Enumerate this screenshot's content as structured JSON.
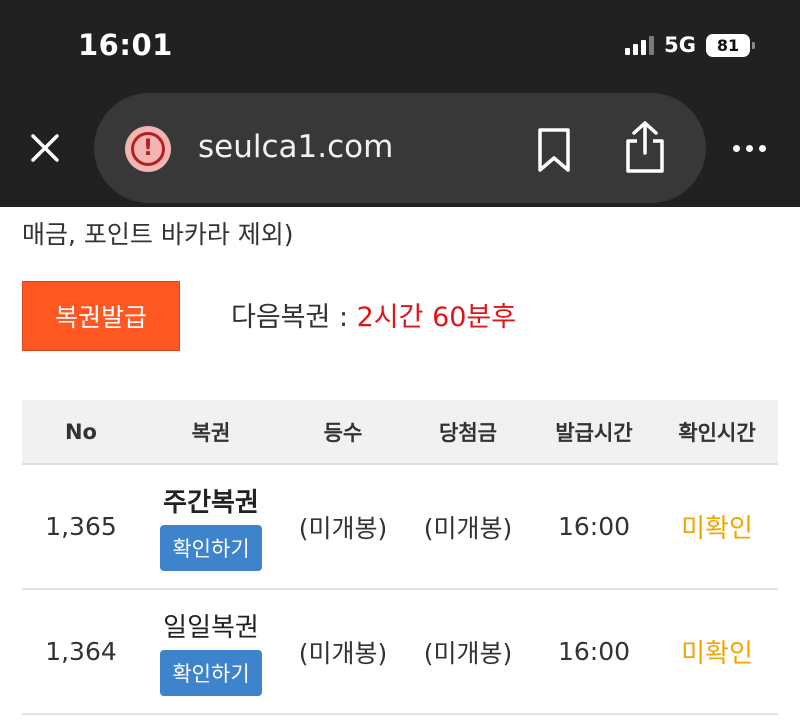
{
  "status_bar": {
    "time": "16:01",
    "network": "5G",
    "battery": "81"
  },
  "browser": {
    "url": "seulca1.com"
  },
  "page": {
    "cut_text": "매금, 포인트 바카라 제외)",
    "issue_button": "복권발급",
    "next_label": "다음복권 : ",
    "next_value": "2시간 60분후"
  },
  "table": {
    "headers": [
      "No",
      "복권",
      "등수",
      "당첨금",
      "발급시간",
      "확인시간"
    ],
    "rows": [
      {
        "no": "1,365",
        "ticket": "주간복권",
        "button": "확인하기",
        "rank": "(미개봉)",
        "prize": "(미개봉)",
        "issued": "16:00",
        "checked": "미확인"
      },
      {
        "no": "1,364",
        "ticket": "일일복권",
        "button": "확인하기",
        "rank": "(미개봉)",
        "prize": "(미개봉)",
        "issued": "16:00",
        "checked": "미확인"
      }
    ]
  },
  "colors": {
    "issue_button": "#ff5722",
    "confirm_button": "#3d84cc",
    "next_value": "#e01515",
    "unconfirmed": "#f0a500",
    "chrome_bg": "#212121"
  },
  "icons": [
    "close-icon",
    "warning-icon",
    "bookmark-icon",
    "share-icon",
    "more-icon",
    "signal-icon",
    "battery-icon"
  ]
}
